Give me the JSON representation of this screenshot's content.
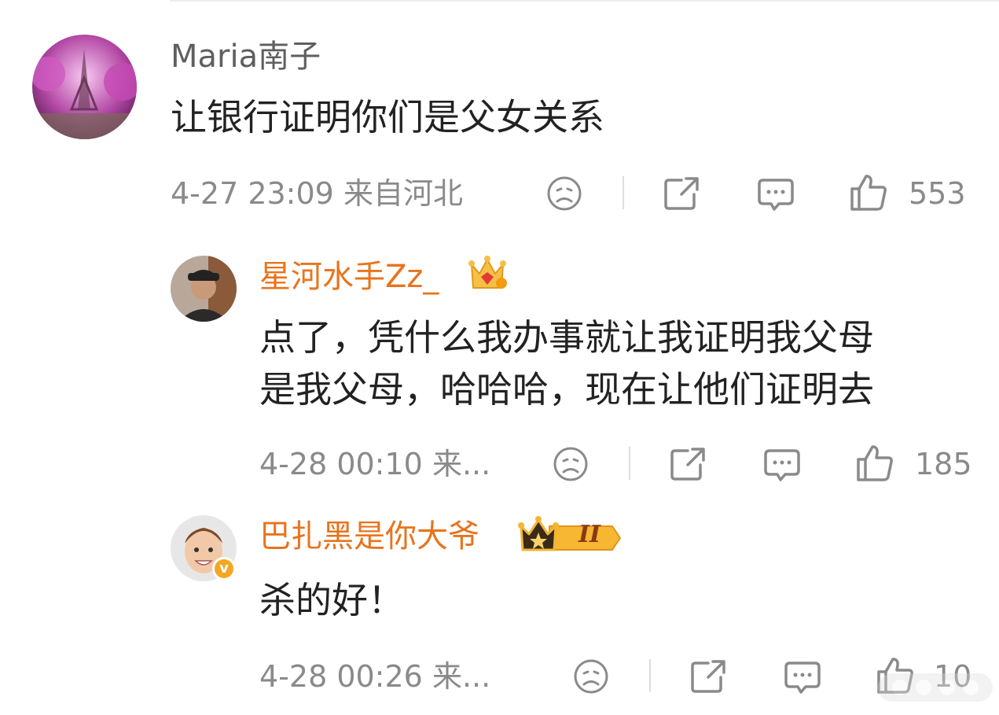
{
  "comments": [
    {
      "user": "Maria南子",
      "text": "让银行证明你们是父女关系",
      "time": "4-27 23:09",
      "location": "来自河北",
      "likes": "553"
    },
    {
      "user": "星河水手Zz_",
      "text_line1": "点了，凭什么我办事就让我证明我父母",
      "text_line2": "是我父母，哈哈哈，现在让他们证明去",
      "time": "4-28 00:10",
      "location": "来...",
      "likes": "185"
    },
    {
      "user": "巴扎黑是你大爷",
      "text": "杀的好！",
      "time": "4-28 00:26",
      "location": "来...",
      "likes": "10"
    }
  ],
  "badges": {
    "vip_level": "II",
    "verified_mark": "v"
  },
  "icons": [
    "sad-face-icon",
    "share-icon",
    "comment-icon",
    "thumbs-up-icon",
    "crown-icon"
  ],
  "colors": {
    "vip_name": "#e8741d",
    "meta_gray": "#8a8a8a",
    "verified_badge": "#f5a623"
  }
}
